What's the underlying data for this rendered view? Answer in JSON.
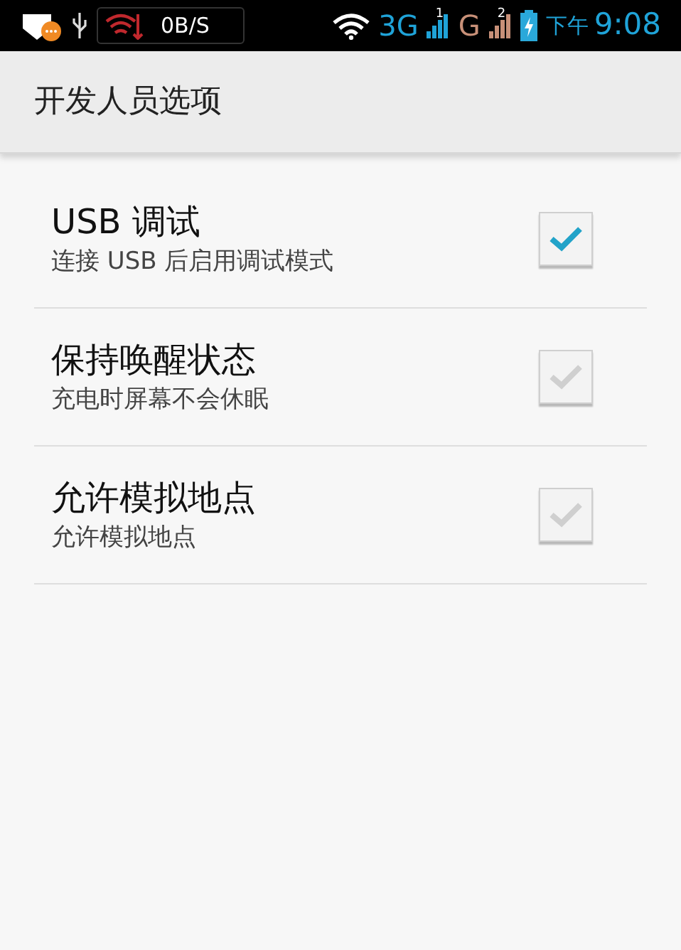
{
  "status_bar": {
    "speed": "0B/S",
    "network_1": "3G",
    "sim_1": "1",
    "network_2": "G",
    "sim_2": "2",
    "period": "下午",
    "time": "9:08"
  },
  "title": "开发人员选项",
  "settings": [
    {
      "title": "USB 调试",
      "summary": "连接 USB 后启用调试模式",
      "checked": true
    },
    {
      "title": "保持唤醒状态",
      "summary": "充电时屏幕不会休眠",
      "checked": false
    },
    {
      "title": "允许模拟地点",
      "summary": "允许模拟地点",
      "checked": false
    }
  ]
}
